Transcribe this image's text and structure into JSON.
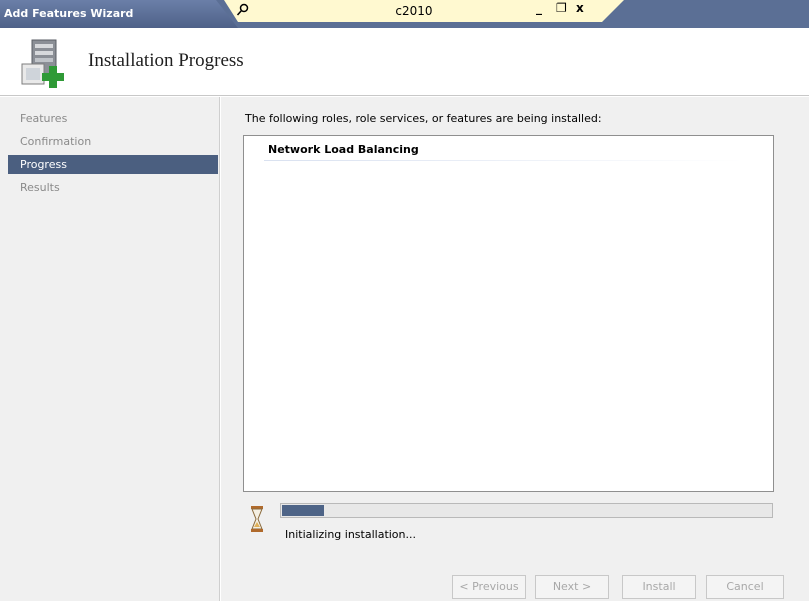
{
  "window": {
    "title": "Add Features Wizard",
    "remote_host": "c2010",
    "controls": {
      "minimize": "_",
      "restore": "❐",
      "close": "x"
    }
  },
  "header": {
    "title": "Installation Progress"
  },
  "nav": {
    "items": [
      {
        "label": "Features",
        "active": false
      },
      {
        "label": "Confirmation",
        "active": false
      },
      {
        "label": "Progress",
        "active": true
      },
      {
        "label": "Results",
        "active": false
      }
    ]
  },
  "main": {
    "intro": "The following roles, role services, or features are being installed:",
    "items": [
      "Network Load Balancing"
    ],
    "progress": {
      "percent": 9
    },
    "status": "Initializing installation..."
  },
  "buttons": {
    "previous": "< Previous",
    "next": "Next >",
    "install": "Install",
    "cancel": "Cancel"
  },
  "colors": {
    "accent": "#4b5f80",
    "progress": "#4e6487",
    "remote_bar": "#fff9d0"
  },
  "icons": [
    "pin-icon",
    "server-add-icon",
    "hourglass-icon"
  ]
}
